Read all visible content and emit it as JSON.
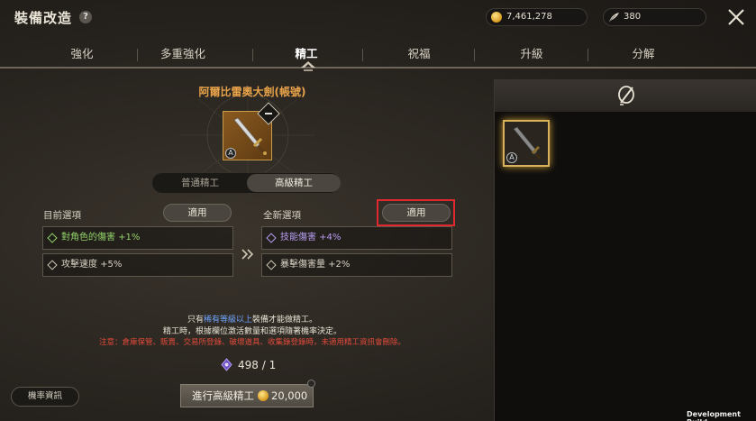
{
  "header": {
    "title": "裝備改造",
    "help_icon": "question-icon",
    "gold_amount": "7,461,278",
    "feather_amount": "380",
    "close_icon": "close-icon"
  },
  "tabs": [
    {
      "label": "強化",
      "active": false
    },
    {
      "label": "多重強化",
      "active": false
    },
    {
      "label": "精工",
      "active": true
    },
    {
      "label": "祝福",
      "active": false
    },
    {
      "label": "升級",
      "active": false
    },
    {
      "label": "分解",
      "active": false
    }
  ],
  "item": {
    "name": "阿爾比雷奧大劍(帳號)",
    "grade": "A"
  },
  "modes": {
    "normal": "普通精工",
    "advanced": "高級精工",
    "active": "advanced"
  },
  "current_options": {
    "label": "目前選項",
    "apply_label": "適用",
    "rows": [
      {
        "text": "對角色的傷害 +1%",
        "color": "green"
      },
      {
        "text": "攻擊速度 +5%",
        "color": "white"
      }
    ]
  },
  "new_options": {
    "label": "全新選項",
    "apply_label": "適用",
    "rows": [
      {
        "text": "技能傷害 +4%",
        "color": "purple"
      },
      {
        "text": "暴擊傷害量 +2%",
        "color": "white"
      }
    ]
  },
  "notices": {
    "line1_pre": "只有",
    "line1_highlight": "稀有等級以上",
    "line1_post": "裝備才能做精工。",
    "line2": "精工時，根據欄位激活數量和選項隨著機率決定。",
    "line3": "注意：倉庫保管、販賣、交易所登錄、破壞道具、收集錄登錄時，未適用精工資訊會刪除。"
  },
  "material": {
    "icon": "purple-gem-icon",
    "count": "498 / 1"
  },
  "buttons": {
    "rates": "機率資訊",
    "execute": "進行高級精工",
    "execute_cost": "20,000"
  },
  "footer": {
    "dev_build": "Development Build"
  },
  "colors": {
    "accent_gold": "#e8a34a",
    "highlight_red": "#e0282f",
    "option_green": "#93d36a",
    "option_purple": "#b79cf0",
    "notice_blue": "#6fa6ff",
    "notice_red": "#e04a3a"
  }
}
